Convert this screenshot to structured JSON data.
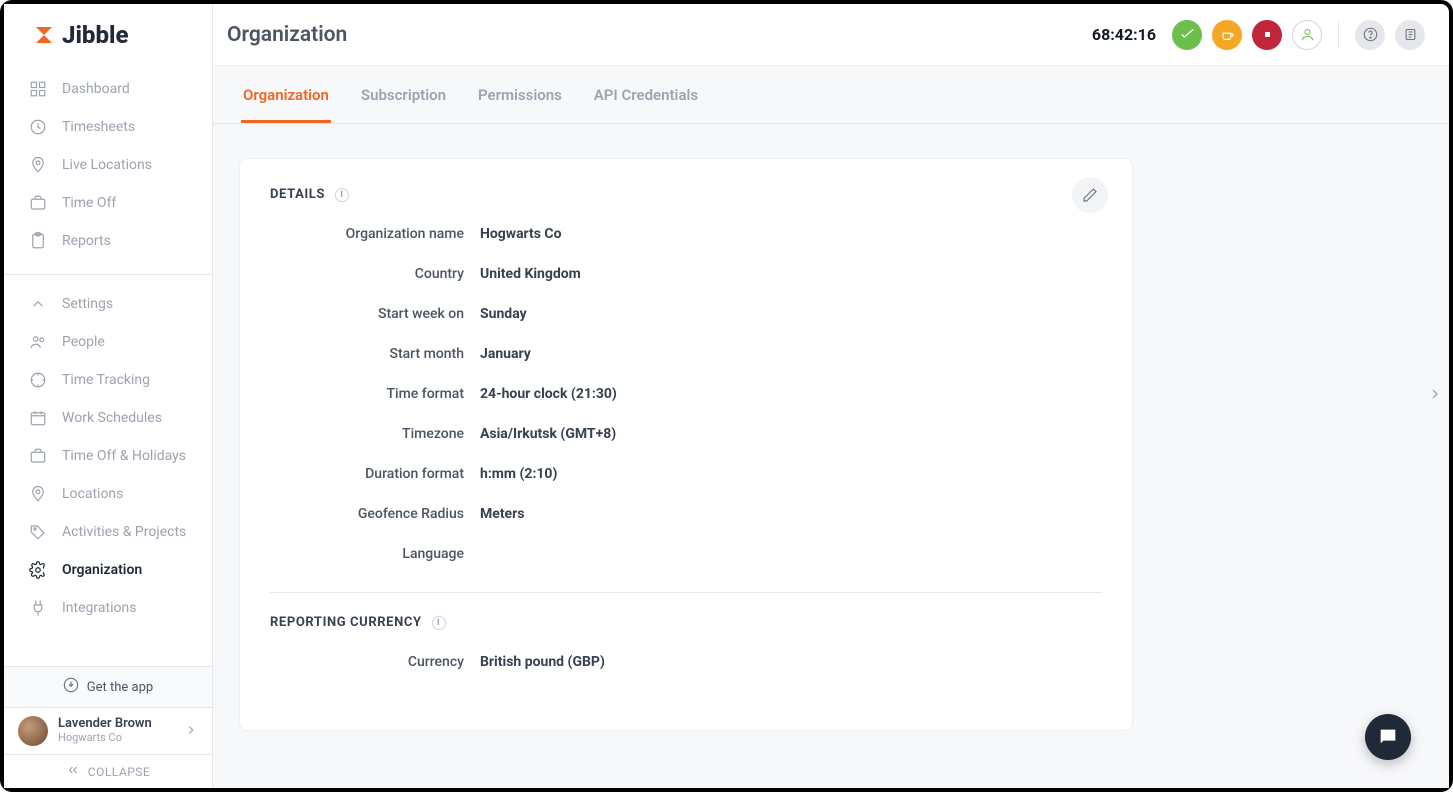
{
  "brand": {
    "name": "Jibble"
  },
  "sidebar": {
    "nav": [
      {
        "label": "Dashboard",
        "icon": "grid"
      },
      {
        "label": "Timesheets",
        "icon": "clock"
      },
      {
        "label": "Live Locations",
        "icon": "pin"
      },
      {
        "label": "Time Off",
        "icon": "briefcase"
      },
      {
        "label": "Reports",
        "icon": "clipboard"
      }
    ],
    "settings_chevron_label": "Settings",
    "settings_nav": [
      {
        "label": "People",
        "icon": "users"
      },
      {
        "label": "Time Tracking",
        "icon": "track"
      },
      {
        "label": "Work Schedules",
        "icon": "schedule"
      },
      {
        "label": "Time Off & Holidays",
        "icon": "briefcase"
      },
      {
        "label": "Locations",
        "icon": "pin"
      },
      {
        "label": "Activities & Projects",
        "icon": "tag"
      },
      {
        "label": "Organization",
        "icon": "gear",
        "active": true
      },
      {
        "label": "Integrations",
        "icon": "plug"
      }
    ],
    "get_app": "Get the app",
    "user": {
      "name": "Lavender Brown",
      "org": "Hogwarts Co"
    },
    "collapse": "COLLAPSE"
  },
  "header": {
    "title": "Organization",
    "timer": "68:42:16"
  },
  "tabs": [
    {
      "label": "Organization",
      "active": true
    },
    {
      "label": "Subscription"
    },
    {
      "label": "Permissions"
    },
    {
      "label": "API Credentials"
    }
  ],
  "details": {
    "section_title": "DETAILS",
    "fields": [
      {
        "k": "Organization name",
        "v": "Hogwarts Co"
      },
      {
        "k": "Country",
        "v": "United Kingdom"
      },
      {
        "k": "Start week on",
        "v": "Sunday"
      },
      {
        "k": "Start month",
        "v": "January"
      },
      {
        "k": "Time format",
        "v": "24-hour clock (21:30)"
      },
      {
        "k": "Timezone",
        "v": "Asia/Irkutsk (GMT+8)"
      },
      {
        "k": "Duration format",
        "v": "h:mm (2:10)"
      },
      {
        "k": "Geofence Radius",
        "v": "Meters"
      },
      {
        "k": "Language",
        "v": ""
      }
    ]
  },
  "currency": {
    "section_title": "REPORTING CURRENCY",
    "fields": [
      {
        "k": "Currency",
        "v": "British pound (GBP)"
      }
    ]
  }
}
